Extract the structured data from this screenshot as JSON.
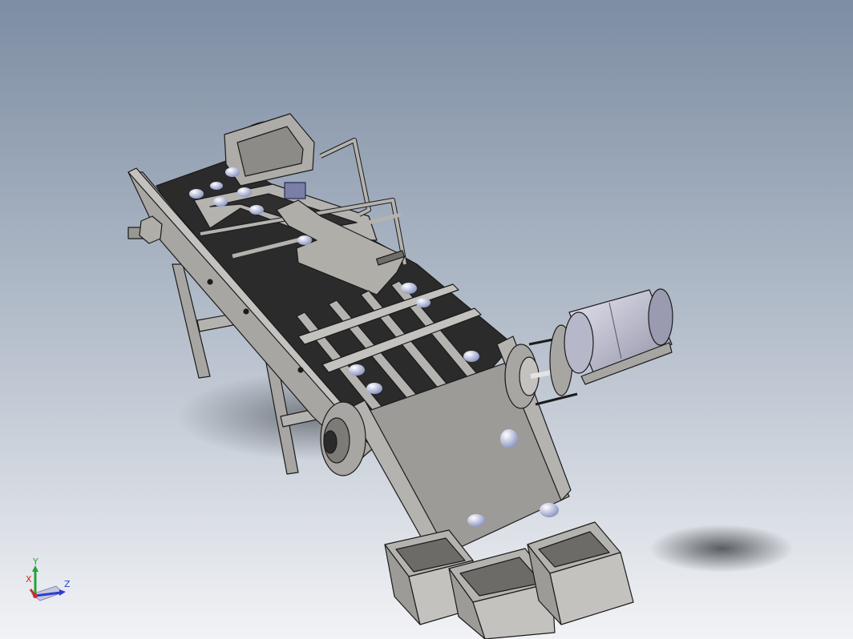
{
  "viewport": {
    "background_top": "#7d8da3",
    "background_bottom": "#f2f3f6"
  },
  "triad": {
    "x_label": "X",
    "y_label": "Y",
    "z_label": "Z",
    "x_color": "#cc2a2a",
    "y_color": "#27a33a",
    "z_color": "#2a3fd0"
  },
  "model": {
    "metal_color": "#a8a6a2",
    "belt_color": "#2b2b2b",
    "motor_color": "#c8c8d4",
    "egg_color": "#c5cbe2"
  }
}
